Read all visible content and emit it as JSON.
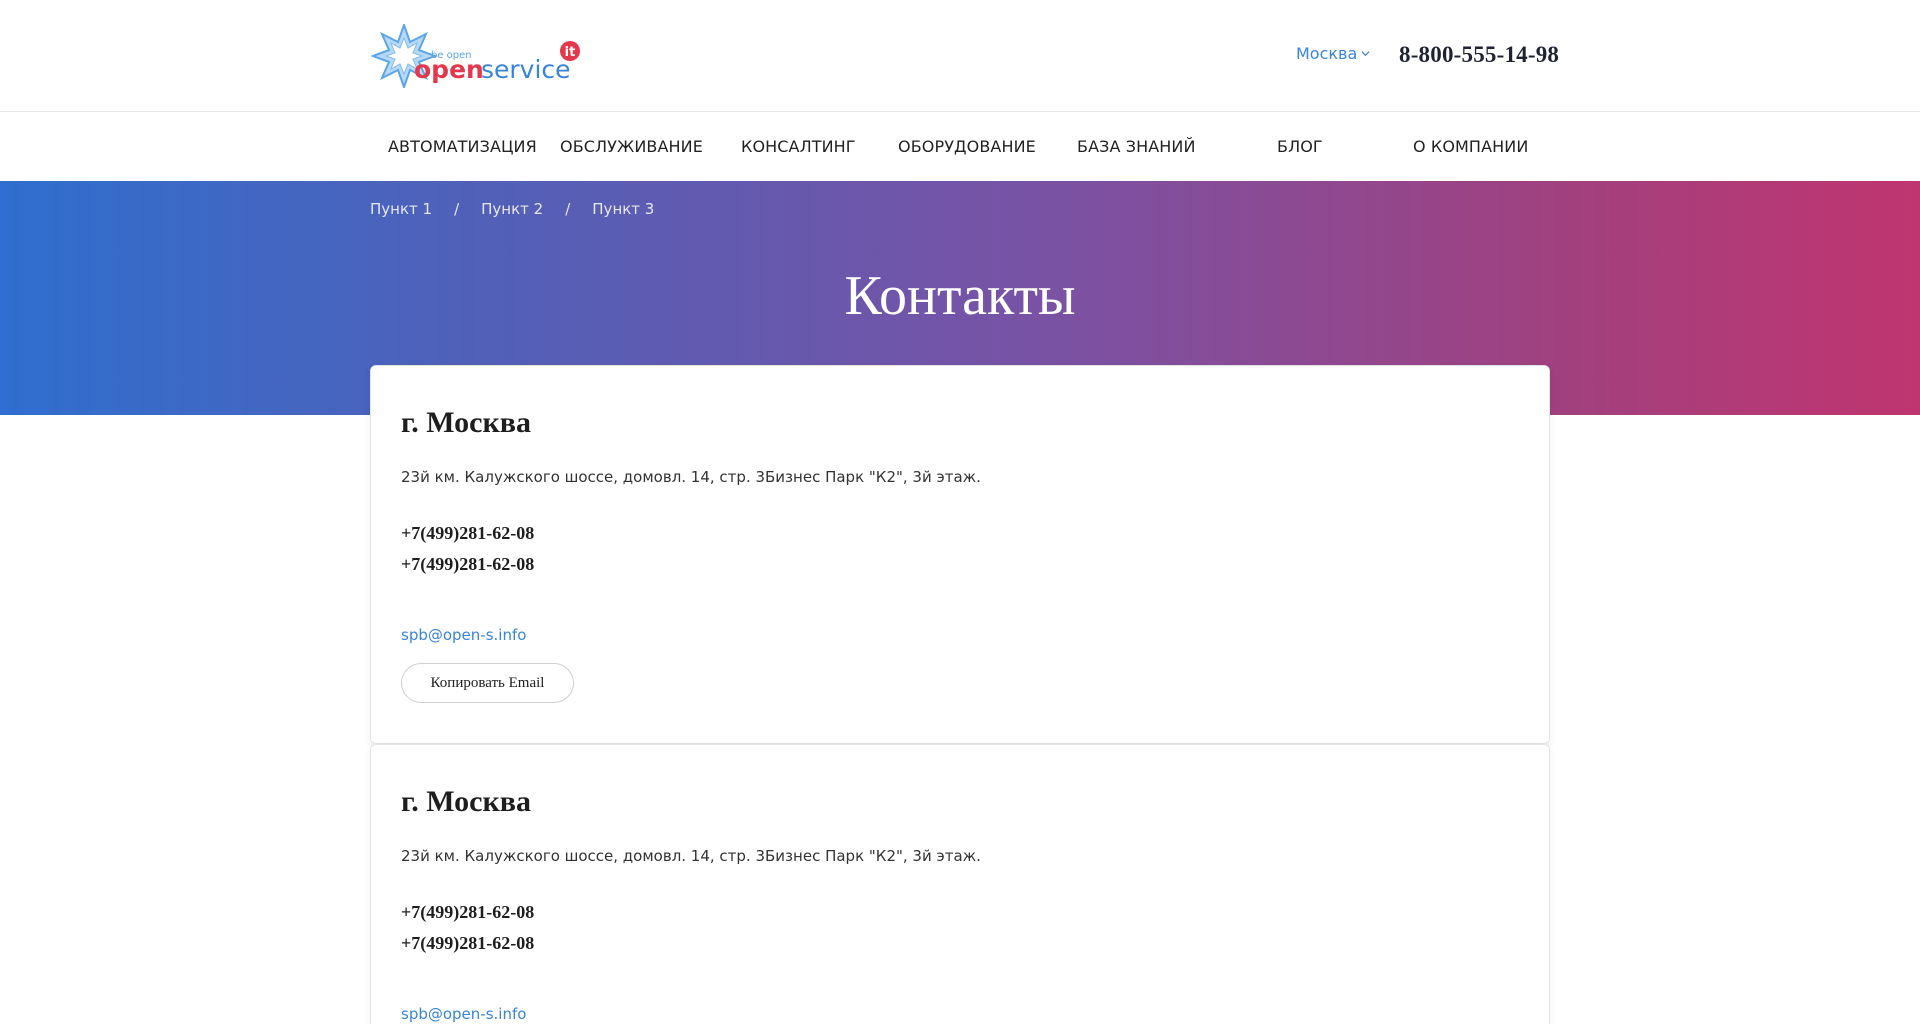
{
  "header": {
    "logo": {
      "tagline": "be open",
      "brand_open": "open",
      "brand_service": "service",
      "badge": "it"
    },
    "city": "Москва",
    "phone": "8-800-555-14-98"
  },
  "nav": {
    "items": [
      "АВТОМАТИЗАЦИЯ",
      "ОБСЛУЖИВАНИЕ",
      "КОНСАЛТИНГ",
      "ОБОРУДОВАНИЕ",
      "БАЗА ЗНАНИЙ",
      "БЛОГ",
      "О КОМПАНИИ"
    ]
  },
  "breadcrumbs": {
    "items": [
      "Пункт 1",
      "Пункт 2",
      "Пункт 3"
    ],
    "separator": "/"
  },
  "page": {
    "title": "Контакты"
  },
  "contacts": [
    {
      "city": "г. Москва",
      "address": "23й км. Калужского шоссе, домовл. 14, стр. 3Бизнес Парк \"К2\", 3й этаж.",
      "phones": [
        "+7(499)281-62-08",
        "+7(499)281-62-08"
      ],
      "email": "spb@open-s.info",
      "copy_label": "Копировать Email"
    },
    {
      "city": "г. Москва",
      "address": "23й км. Калужского шоссе, домовл. 14, стр. 3Бизнес Парк \"К2\", 3й этаж.",
      "phones": [
        "+7(499)281-62-08",
        "+7(499)281-62-08"
      ],
      "email": "spb@open-s.info"
    }
  ],
  "colors": {
    "accent": "#3a84d6",
    "gradient_start": "#2f6fcf",
    "gradient_end": "#c03570",
    "logo_red": "#e2384b"
  }
}
